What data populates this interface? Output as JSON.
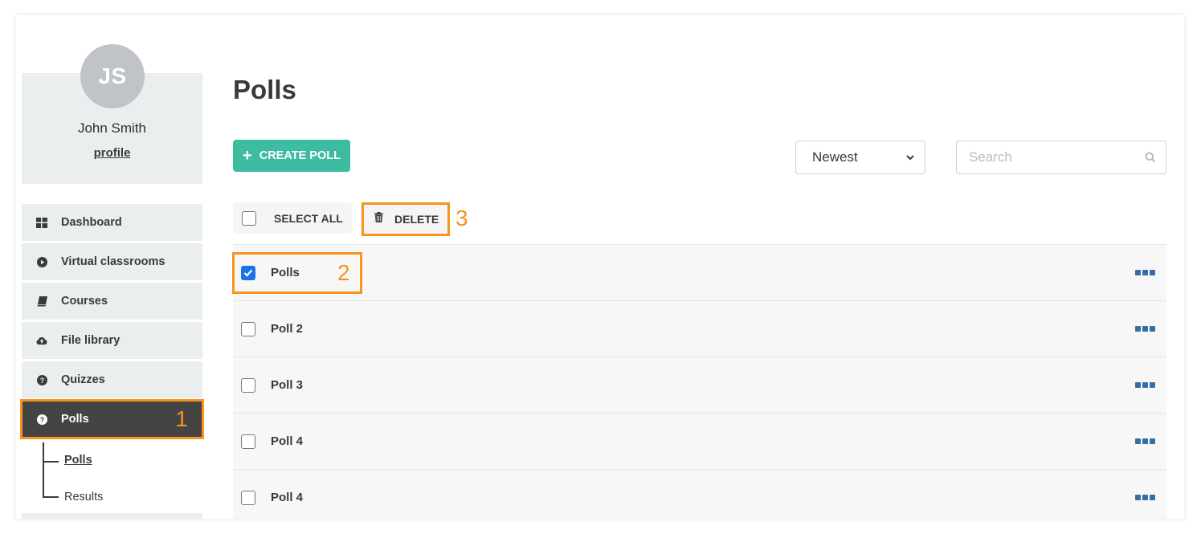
{
  "user": {
    "initials": "JS",
    "name": "John Smith",
    "profile_link": "profile"
  },
  "sidebar": {
    "items": [
      {
        "label": "Dashboard",
        "icon": "dashboard-grid-icon"
      },
      {
        "label": "Virtual classrooms",
        "icon": "play-circle-icon"
      },
      {
        "label": "Courses",
        "icon": "book-icon"
      },
      {
        "label": "File library",
        "icon": "cloud-upload-icon"
      },
      {
        "label": "Quizzes",
        "icon": "question-circle-icon"
      },
      {
        "label": "Polls",
        "icon": "question-circle-icon",
        "active": true,
        "annotation": "1"
      }
    ],
    "subitems": [
      {
        "label": "Polls",
        "active": true
      },
      {
        "label": "Results"
      }
    ]
  },
  "main": {
    "title": "Polls",
    "create_button": "CREATE POLL",
    "sort": {
      "selected": "Newest"
    },
    "search": {
      "placeholder": "Search",
      "value": ""
    },
    "bulk": {
      "select_all": "SELECT ALL",
      "delete": "DELETE",
      "delete_annotation": "3"
    },
    "polls": [
      {
        "name": "Polls",
        "checked": true,
        "annotation": "2"
      },
      {
        "name": "Poll 2",
        "checked": false
      },
      {
        "name": "Poll 3",
        "checked": false
      },
      {
        "name": "Poll 4",
        "checked": false
      },
      {
        "name": "Poll 4",
        "checked": false
      }
    ]
  },
  "colors": {
    "accent": "#3dbca1",
    "highlight": "#f7941d",
    "active_nav": "#444444",
    "more_dots": "#386ea6",
    "checkbox_checked": "#1a73e8"
  }
}
